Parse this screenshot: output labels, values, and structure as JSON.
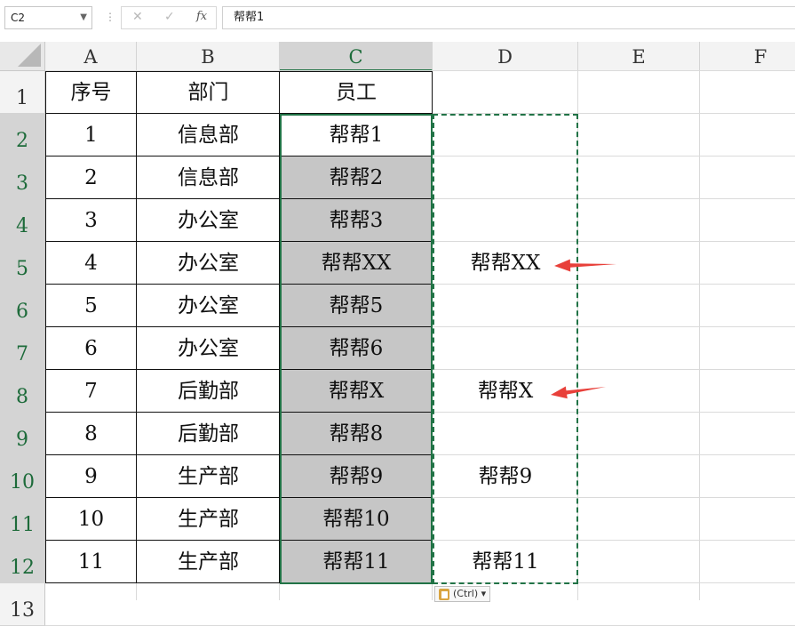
{
  "formula_bar": {
    "name_box": "C2",
    "cancel_glyph": "✕",
    "enter_glyph": "✓",
    "fx_label": "fx",
    "formula": "帮帮1"
  },
  "columns": [
    "A",
    "B",
    "C",
    "D",
    "E",
    "F"
  ],
  "rows": [
    "1",
    "2",
    "3",
    "4",
    "5",
    "6",
    "7",
    "8",
    "9",
    "10",
    "11",
    "12",
    "13"
  ],
  "table": {
    "headers": [
      "序号",
      "部门",
      "员工"
    ],
    "seq": [
      "1",
      "2",
      "3",
      "4",
      "5",
      "6",
      "7",
      "8",
      "9",
      "10",
      "11"
    ],
    "dept": [
      "信息部",
      "信息部",
      "办公室",
      "办公室",
      "办公室",
      "办公室",
      "后勤部",
      "后勤部",
      "生产部",
      "生产部",
      "生产部"
    ],
    "staff": [
      "帮帮1",
      "帮帮2",
      "帮帮3",
      "帮帮XX",
      "帮帮5",
      "帮帮6",
      "帮帮X",
      "帮帮8",
      "帮帮9",
      "帮帮10",
      "帮帮11"
    ]
  },
  "column_d": [
    "",
    "",
    "",
    "帮帮XX",
    "",
    "",
    "帮帮X",
    "",
    "帮帮9",
    "",
    "帮帮11"
  ],
  "paste_options": {
    "label": "(Ctrl)"
  },
  "colors": {
    "selection_green": "#217346",
    "selection_fill": "#c6c6c6",
    "arrow_red": "#e8403a"
  }
}
